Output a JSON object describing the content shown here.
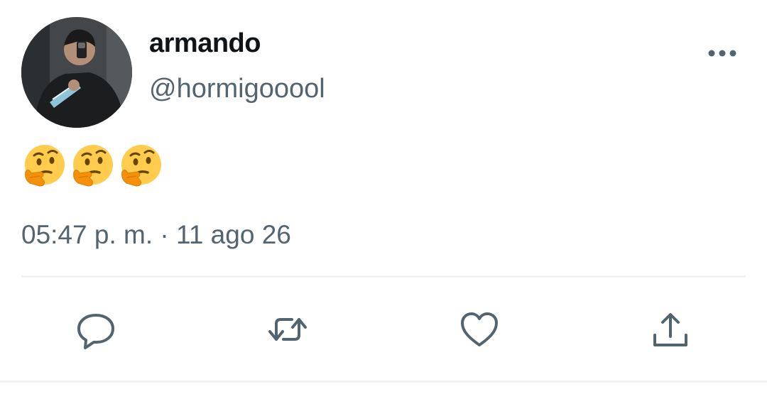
{
  "user": {
    "display_name": "armando",
    "handle": "@hormigooool",
    "avatar_icon": "profile-photo"
  },
  "tweet": {
    "content_icons": [
      "thinking-face-emoji",
      "thinking-face-emoji",
      "thinking-face-emoji"
    ],
    "timestamp": "05:47 p. m. · 11 ago 26"
  },
  "actions": [
    {
      "name": "reply",
      "icon": "reply-icon"
    },
    {
      "name": "retweet",
      "icon": "retweet-icon"
    },
    {
      "name": "like",
      "icon": "heart-icon"
    },
    {
      "name": "share",
      "icon": "share-icon"
    }
  ],
  "colors": {
    "text_primary": "#0f1419",
    "text_secondary": "#536471",
    "divider": "#eff3f4",
    "emoji_yellow": "#FFCC4D"
  }
}
